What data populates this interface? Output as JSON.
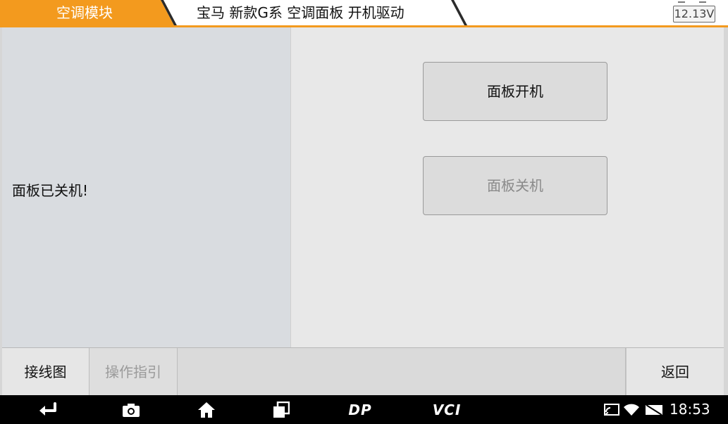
{
  "header": {
    "module_tab": "空调模块",
    "path_tab": "宝马 新款G系 空调面板 开机驱动",
    "battery_voltage": "12.13V"
  },
  "status": {
    "message": "面板已关机!"
  },
  "actions": {
    "panel_on_label": "面板开机",
    "panel_off_label": "面板关机"
  },
  "bottom_bar": {
    "wiring_label": "接线图",
    "guide_label": "操作指引",
    "back_label": "返回"
  },
  "navbar": {
    "icons": [
      "back-icon",
      "camera-icon",
      "home-icon",
      "recent-apps-icon",
      "dp-icon",
      "vci-icon",
      "cast-icon",
      "wifi-icon",
      "no-sim-icon"
    ],
    "dp_label": "DP",
    "vci_label": "VCI",
    "clock": "18:53"
  },
  "colors": {
    "accent": "#f39a1e",
    "tab_dark": "#2b2b2b",
    "panel_left": "#d9dce0",
    "panel_right": "#e8e8e8"
  }
}
